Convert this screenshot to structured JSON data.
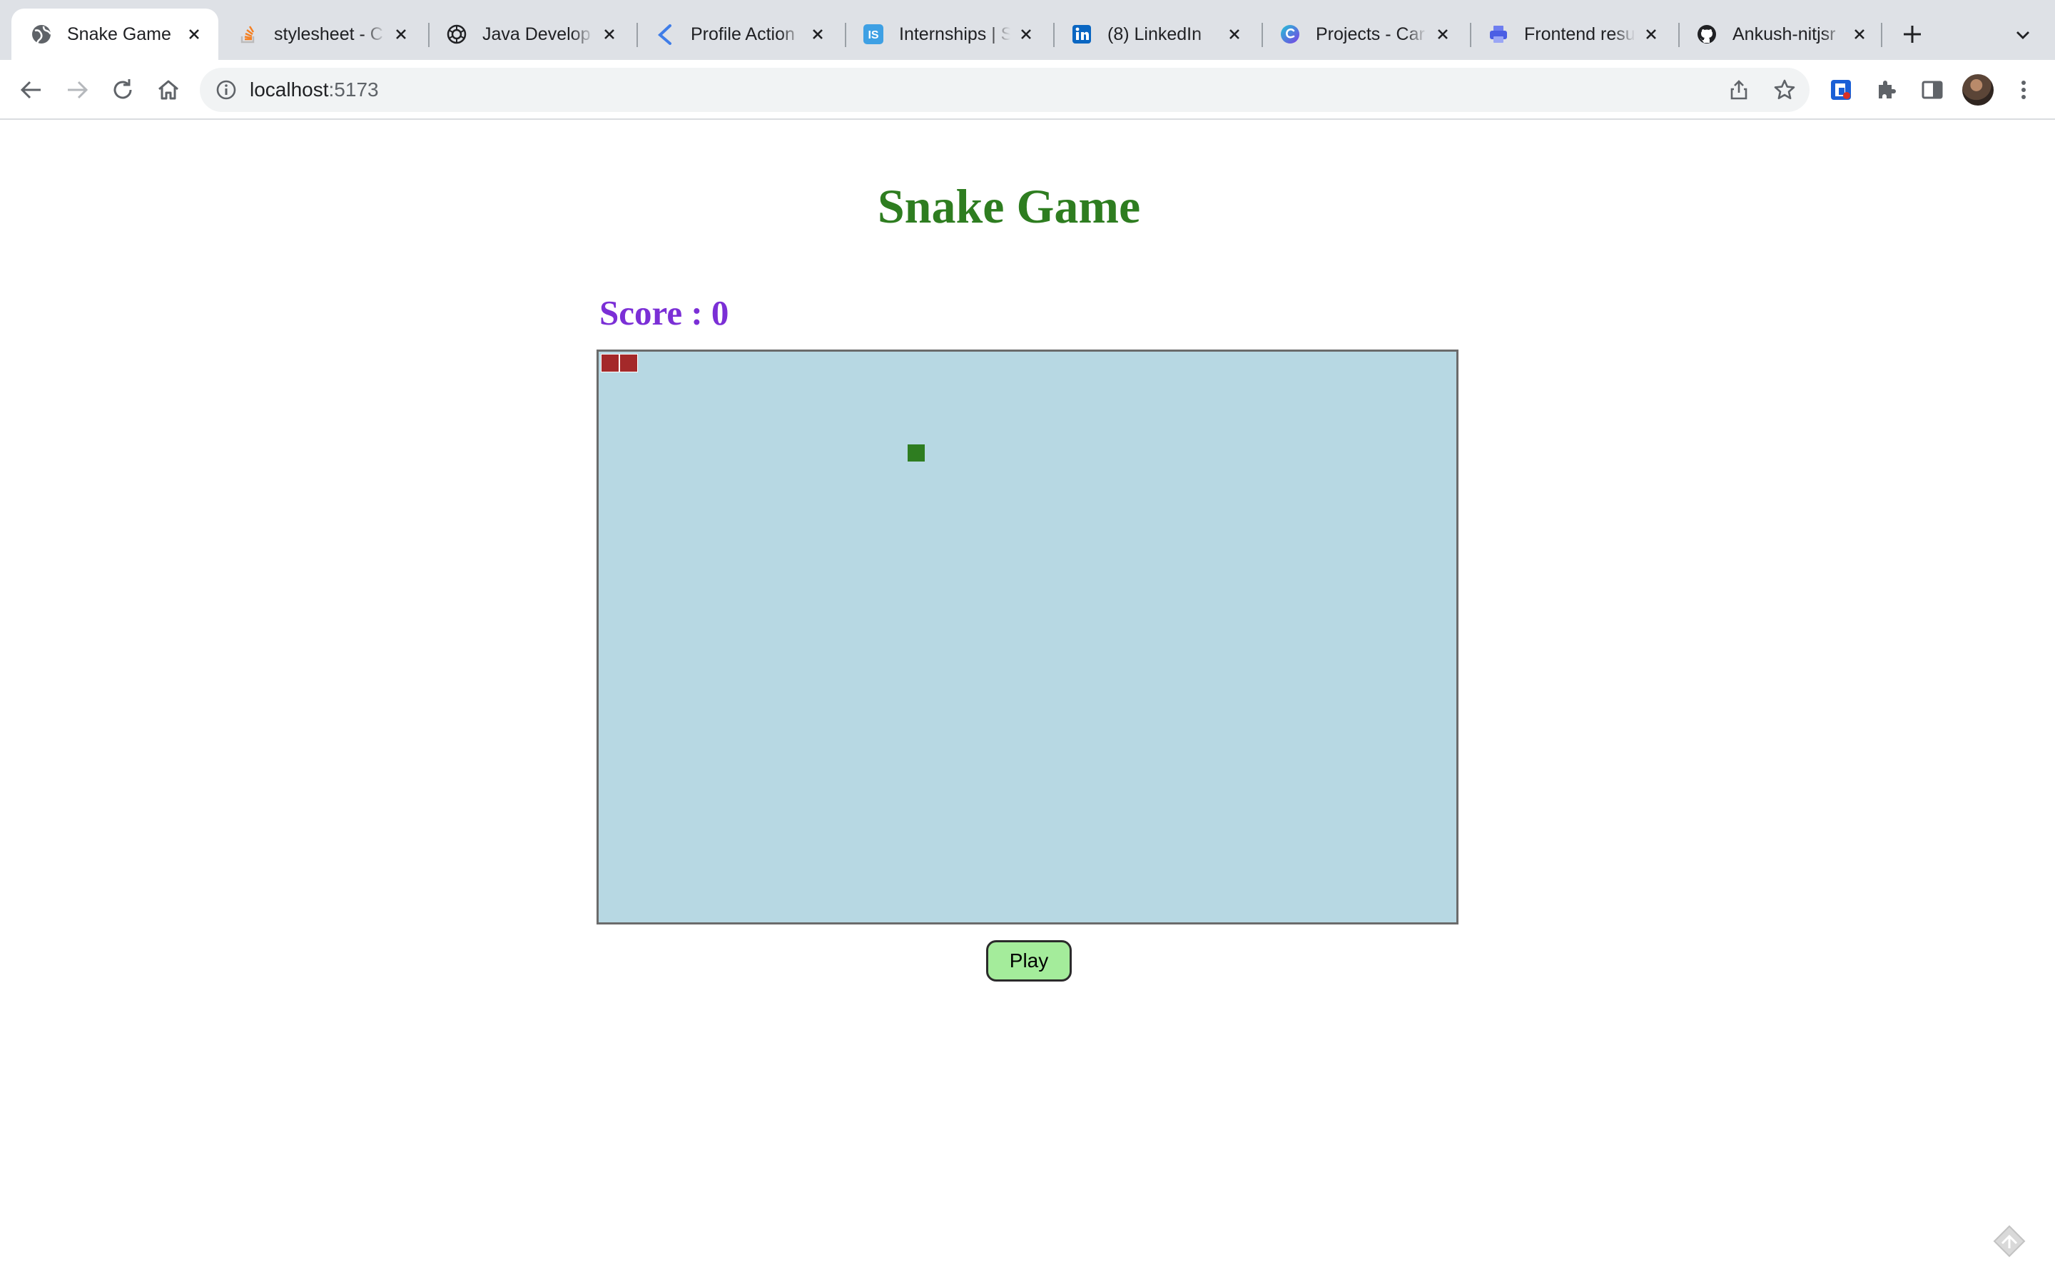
{
  "browser": {
    "tabs": [
      {
        "title": "Snake Game",
        "icon": "globe-icon",
        "active": true
      },
      {
        "title": "stylesheet - C",
        "icon": "stackoverflow-icon",
        "active": false
      },
      {
        "title": "Java Develop",
        "icon": "openai-icon",
        "active": false
      },
      {
        "title": "Profile Action",
        "icon": "kotlin-icon",
        "active": false
      },
      {
        "title": "Internships | S",
        "icon": "internshala-icon",
        "active": false
      },
      {
        "title": "(8) LinkedIn",
        "icon": "linkedin-icon",
        "active": false
      },
      {
        "title": "Projects - Car",
        "icon": "canva-icon",
        "active": false
      },
      {
        "title": "Frontend resu",
        "icon": "printer-icon",
        "active": false
      },
      {
        "title": "Ankush-nitjsr",
        "icon": "github-icon",
        "active": false
      }
    ],
    "address": {
      "host": "localhost",
      "port": ":5173"
    }
  },
  "game": {
    "title": "Snake Game",
    "score_label": "Score : 0",
    "play_label": "Play",
    "colors": {
      "title": "#2e7d20",
      "score": "#7b2fd6",
      "board": "#b7d8e3",
      "snake": "#a4292a",
      "food": "#2e7d20",
      "button": "#a4ec9b"
    }
  }
}
